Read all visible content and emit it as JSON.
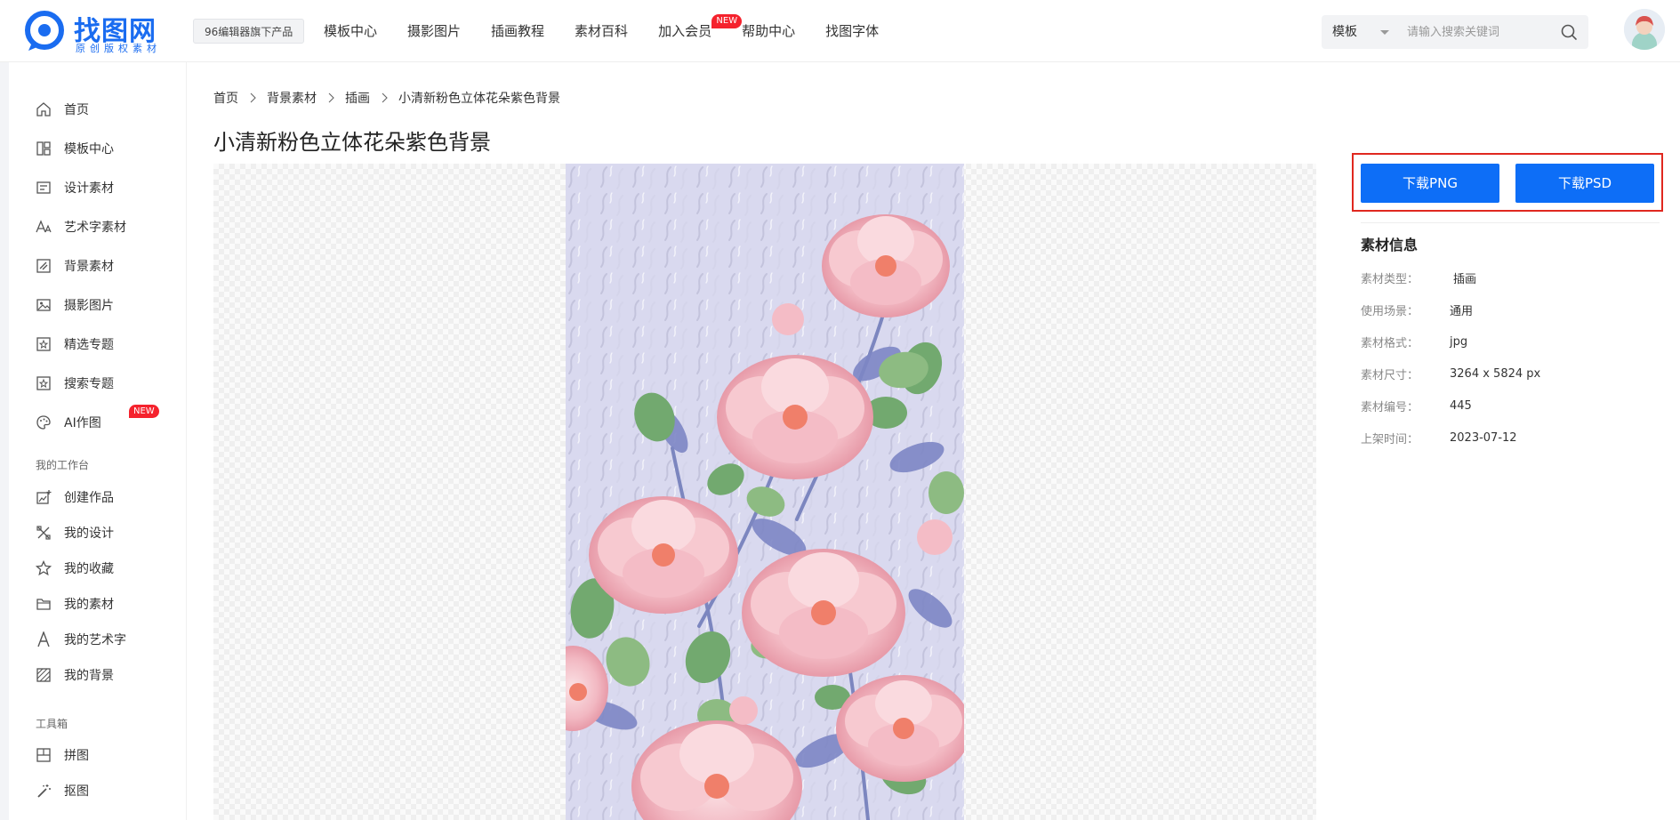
{
  "header": {
    "logo": {
      "title": "找图网",
      "subtitle": "原创版权素材"
    },
    "tagline": "96编辑器旗下产品",
    "nav": [
      {
        "label": "模板中心"
      },
      {
        "label": "摄影图片"
      },
      {
        "label": "插画教程"
      },
      {
        "label": "素材百科"
      },
      {
        "label": "加入会员",
        "badge": "NEW"
      },
      {
        "label": "帮助中心"
      },
      {
        "label": "找图字体"
      }
    ],
    "search": {
      "type": "模板",
      "placeholder": "请输入搜索关键词"
    }
  },
  "sidebar": {
    "items": [
      {
        "label": "首页",
        "icon": "home-icon"
      },
      {
        "label": "模板中心",
        "icon": "template-icon"
      },
      {
        "label": "设计素材",
        "icon": "design-material-icon"
      },
      {
        "label": "艺术字素材",
        "icon": "font-art-icon"
      },
      {
        "label": "背景素材",
        "icon": "background-icon"
      },
      {
        "label": "摄影图片",
        "icon": "photo-icon"
      },
      {
        "label": "精选专题",
        "icon": "featured-icon"
      },
      {
        "label": "搜索专题",
        "icon": "search-topic-icon"
      },
      {
        "label": "AI作图",
        "icon": "palette-icon",
        "badge": "NEW"
      }
    ],
    "workspace_title": "我的工作台",
    "workspace": [
      {
        "label": "创建作品",
        "icon": "create-work-icon"
      },
      {
        "label": "我的设计",
        "icon": "my-design-icon"
      },
      {
        "label": "我的收藏",
        "icon": "star-icon"
      },
      {
        "label": "我的素材",
        "icon": "folder-icon"
      },
      {
        "label": "我的艺术字",
        "icon": "letter-a-icon"
      },
      {
        "label": "我的背景",
        "icon": "stripes-icon"
      }
    ],
    "tools_title": "工具箱",
    "tools": [
      {
        "label": "拼图",
        "icon": "collage-icon"
      },
      {
        "label": "抠图",
        "icon": "magic-wand-icon"
      }
    ]
  },
  "breadcrumb": [
    "首页",
    "背景素材",
    "插画",
    "小清新粉色立体花朵紫色背景"
  ],
  "title": "小清新粉色立体花朵紫色背景",
  "actions": {
    "download_png": "下载PNG",
    "download_psd": "下载PSD"
  },
  "info": {
    "title": "素材信息",
    "rows": [
      {
        "key": "素材类型：",
        "value": "插画"
      },
      {
        "key": "使用场景：",
        "value": "通用"
      },
      {
        "key": "素材格式：",
        "value": "jpg"
      },
      {
        "key": "素材尺寸：",
        "value": "3264 x 5824 px"
      },
      {
        "key": "素材编号：",
        "value": "445"
      },
      {
        "key": "上架时间：",
        "value": "2023-07-12"
      }
    ]
  },
  "colors": {
    "brand": "#1a6cf0",
    "button": "#0d6ef7",
    "highlight": "#e0281f",
    "badge": "#f5222d"
  }
}
